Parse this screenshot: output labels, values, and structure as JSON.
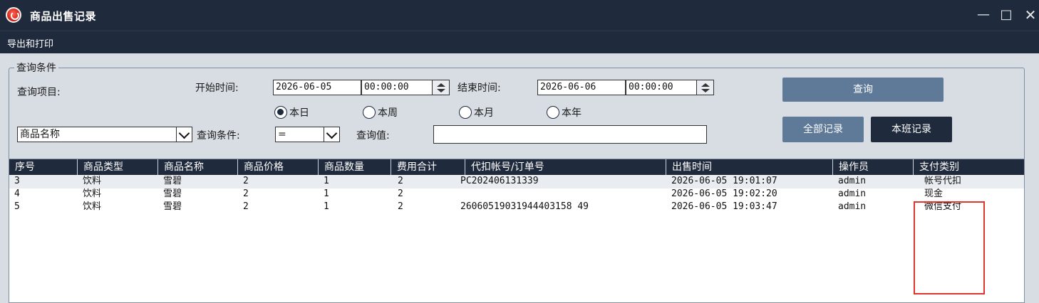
{
  "window": {
    "title": "商品出售记录",
    "minimize": "—",
    "maximize": "□",
    "close": "✕"
  },
  "menu": {
    "items": [
      "导出和打印"
    ]
  },
  "query": {
    "group_title": "查询条件",
    "item_label": "查询项目:",
    "start_label": "开始时间:",
    "start_date": "2026-06-05",
    "start_time": "00:00:00",
    "end_label": "结束时间:",
    "end_date": "2026-06-06",
    "end_time": "00:00:00",
    "ranges": [
      "本日",
      "本周",
      "本月",
      "本年"
    ],
    "selected_range": "本日",
    "field_select": "商品名称",
    "condition_label": "查询条件:",
    "operator": "=",
    "value_label": "查询值:",
    "value": ""
  },
  "buttons": {
    "query": "查询",
    "all_records": "全部记录",
    "shift_records": "本班记录"
  },
  "table": {
    "columns": [
      "序号",
      "商品类型",
      "商品名称",
      "商品价格",
      "商品数量",
      "费用合计",
      "代扣帐号/订单号",
      "出售时间",
      "操作员",
      "支付类别"
    ],
    "rows": [
      [
        "3",
        "饮料",
        "雪碧",
        "2",
        "1",
        "2",
        "PC202406131339",
        "2026-06-05 19:01:07",
        "admin",
        "帐号代扣"
      ],
      [
        "4",
        "饮料",
        "雪碧",
        "2",
        "1",
        "2",
        "",
        "2026-06-05 19:02:20",
        "admin",
        "现金"
      ],
      [
        "5",
        "饮料",
        "雪碧",
        "2",
        "1",
        "2",
        "26060519031944403158 49",
        "2026-06-05 19:03:47",
        "admin",
        "微信支付"
      ]
    ]
  },
  "colors": {
    "titlebar": "#1f2a3c",
    "panel": "#d8dde4",
    "button": "#5e7a98",
    "highlight": "#e0342d"
  }
}
